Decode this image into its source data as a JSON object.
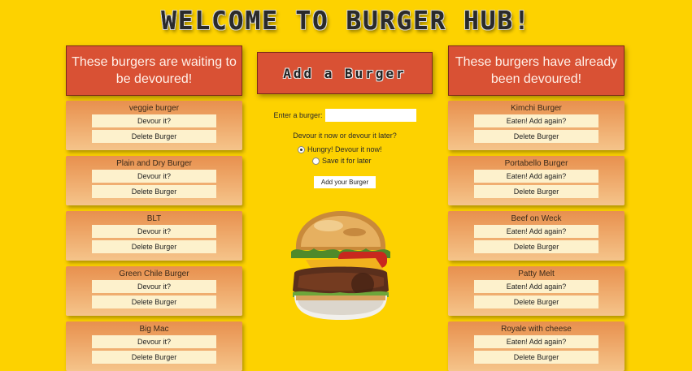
{
  "header": {
    "title": "WELCOME TO BURGER HUB!"
  },
  "left": {
    "title": "These burgers are waiting to be devoured!",
    "burgers": [
      {
        "name": "veggie burger",
        "action": "Devour it?",
        "delete": "Delete Burger"
      },
      {
        "name": "Plain and Dry Burger",
        "action": "Devour it?",
        "delete": "Delete Burger"
      },
      {
        "name": "BLT",
        "action": "Devour it?",
        "delete": "Delete Burger"
      },
      {
        "name": "Green Chile Burger",
        "action": "Devour it?",
        "delete": "Delete Burger"
      },
      {
        "name": "Big Mac",
        "action": "Devour it?",
        "delete": "Delete Burger"
      }
    ]
  },
  "middle": {
    "title": "Add a Burger",
    "input_label": "Enter a burger:",
    "input_value": "",
    "question": "Devour it now or devour it later?",
    "option_now": "Hungry! Devour it now!",
    "option_later": "Save it for later",
    "submit": "Add your Burger"
  },
  "right": {
    "title": "These burgers have already been devoured!",
    "burgers": [
      {
        "name": "Kimchi Burger",
        "action": "Eaten! Add again?",
        "delete": "Delete Burger"
      },
      {
        "name": "Portabello Burger",
        "action": "Eaten! Add again?",
        "delete": "Delete Burger"
      },
      {
        "name": "Beef on Weck",
        "action": "Eaten! Add again?",
        "delete": "Delete Burger"
      },
      {
        "name": "Patty Melt",
        "action": "Eaten! Add again?",
        "delete": "Delete Burger"
      },
      {
        "name": "Royale with cheese",
        "action": "Eaten! Add again?",
        "delete": "Delete Burger"
      }
    ]
  },
  "colors": {
    "background": "#fdd200",
    "header_box": "#d95134",
    "card_top": "#e8904e",
    "card_bottom": "#f5c48a",
    "button": "#fdf1cc"
  }
}
